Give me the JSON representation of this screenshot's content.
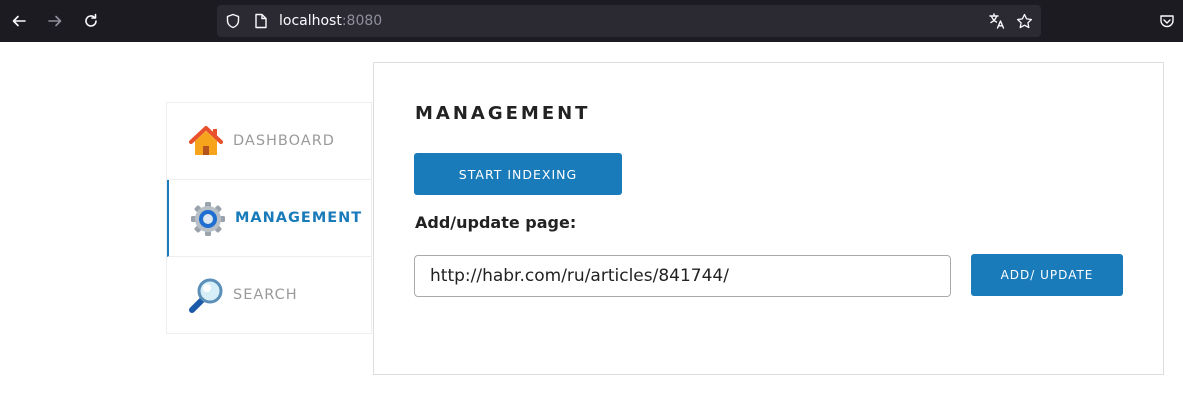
{
  "browser": {
    "url_host": "localhost",
    "url_port": ":8080"
  },
  "sidebar": {
    "items": [
      {
        "label": "DASHBOARD",
        "icon": "home-icon",
        "active": false
      },
      {
        "label": "MANAGEMENT",
        "icon": "gear-icon",
        "active": true
      },
      {
        "label": "SEARCH",
        "icon": "magnifier-icon",
        "active": false
      }
    ]
  },
  "main": {
    "title": "MANAGEMENT",
    "start_indexing_label": "START INDEXING",
    "add_update_label": "Add/update page:",
    "page_url_value": "http://habr.com/ru/articles/841744/",
    "add_button_label": "ADD/ UPDATE"
  },
  "colors": {
    "accent": "#1a7bbb",
    "chrome_bg": "#1c1b22",
    "urlbar_bg": "#2b2a33"
  }
}
